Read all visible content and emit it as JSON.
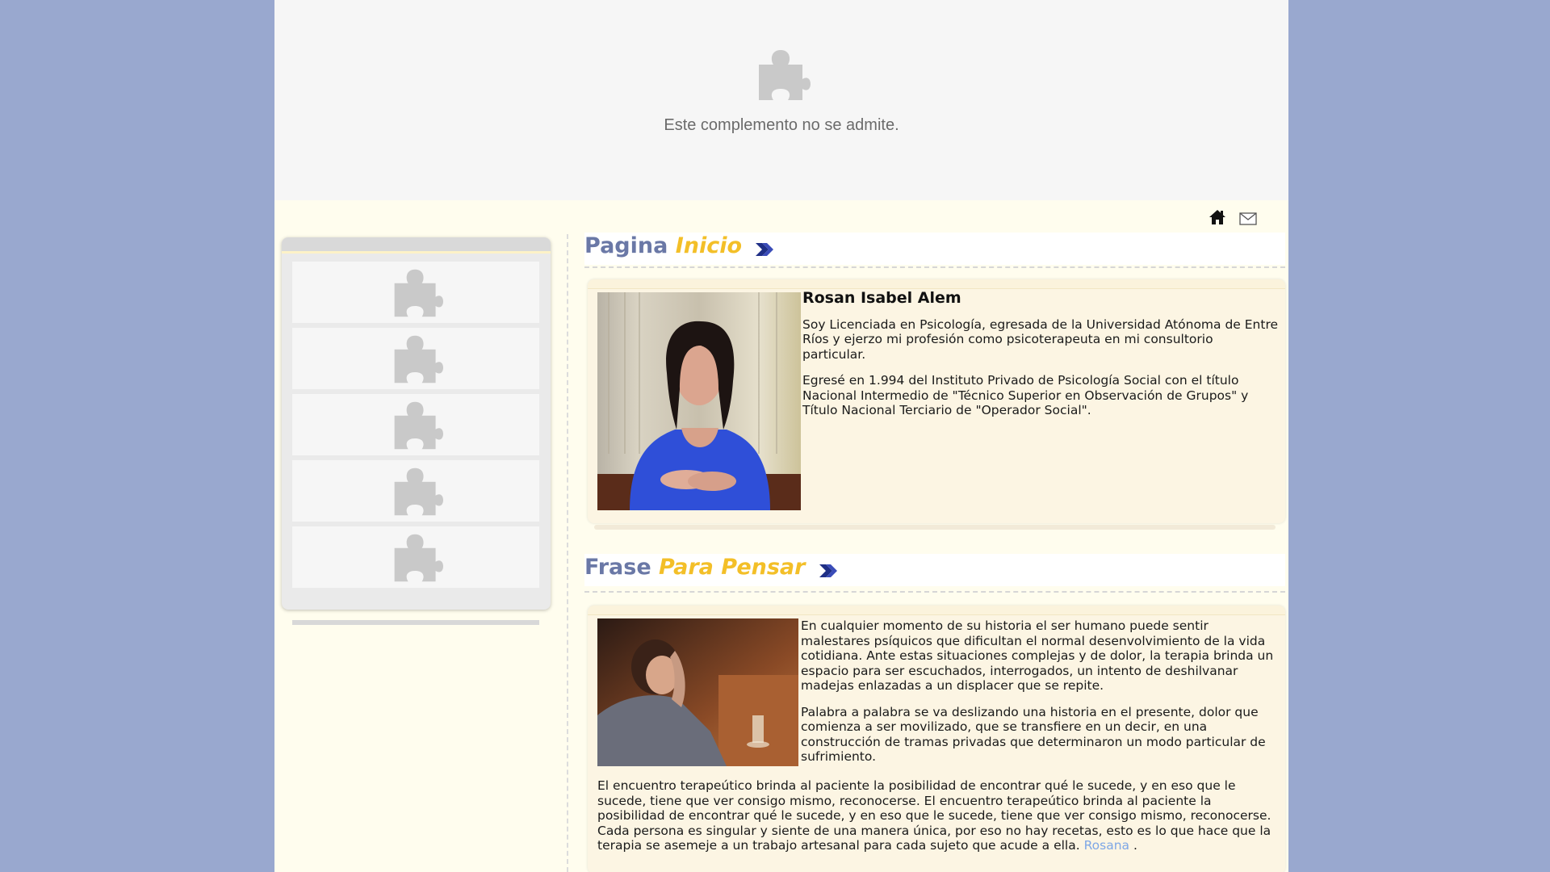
{
  "plugin_banner": {
    "message": "Este complemento no se admite.",
    "icon": "puzzle-piece-icon"
  },
  "top_icons": [
    {
      "name": "home-icon"
    },
    {
      "name": "mail-icon"
    }
  ],
  "sidebar": {
    "slots": [
      {
        "icon": "puzzle-piece-icon"
      },
      {
        "icon": "puzzle-piece-icon"
      },
      {
        "icon": "puzzle-piece-icon"
      },
      {
        "icon": "puzzle-piece-icon"
      },
      {
        "icon": "puzzle-piece-icon"
      }
    ]
  },
  "section1": {
    "title_part1": "Pagina",
    "title_part2": "Inicio",
    "name": "Rosan Isabel Alem",
    "paragraphs": [
      "Soy Licenciada en Psicología, egresada de la Universidad Atónoma de Entre Ríos y ejerzo mi profesión como psicoterapeuta en mi consultorio particular.",
      "Egresé en 1.994 del Instituto Privado de Psicología Social con el título Nacional Intermedio de \"Técnico Superior en Observación de Grupos\" y Título Nacional Terciario de \"Operador Social\"."
    ]
  },
  "section2": {
    "title_part1": "Frase",
    "title_part2": "Para Pensar",
    "paragraphs": [
      "En cualquier momento de su historia el ser humano puede sentir malestares psíquicos que dificultan el normal desenvolvimiento de la vida cotidiana. Ante estas situaciones complejas y de dolor, la terapia brinda un espacio para ser escuchados, interrogados, un intento de deshilvanar madejas enlazadas a un displacer que se repite.",
      "Palabra a palabra se va deslizando una historia en el presente, dolor que comienza a ser movilizado, que se transfiere en un decir, en una construcción de tramas privadas que determinaron un modo particular de sufrimiento.",
      "El encuentro terapeútico brinda al paciente la posibilidad de encontrar qué le sucede, y en eso que le sucede, tiene que ver consigo mismo, reconocerse. El encuentro terapeútico brinda al paciente la posibilidad de encontrar qué le sucede, y en eso que le sucede, tiene que ver consigo mismo, reconocerse. Cada persona es singular y siente de una manera única, por eso no hay recetas, esto es lo que hace que la terapia se asemeje a un trabajo artesanal para cada sujeto que acude a ella."
    ],
    "link_text": "Rosana",
    "after_link": " ."
  }
}
